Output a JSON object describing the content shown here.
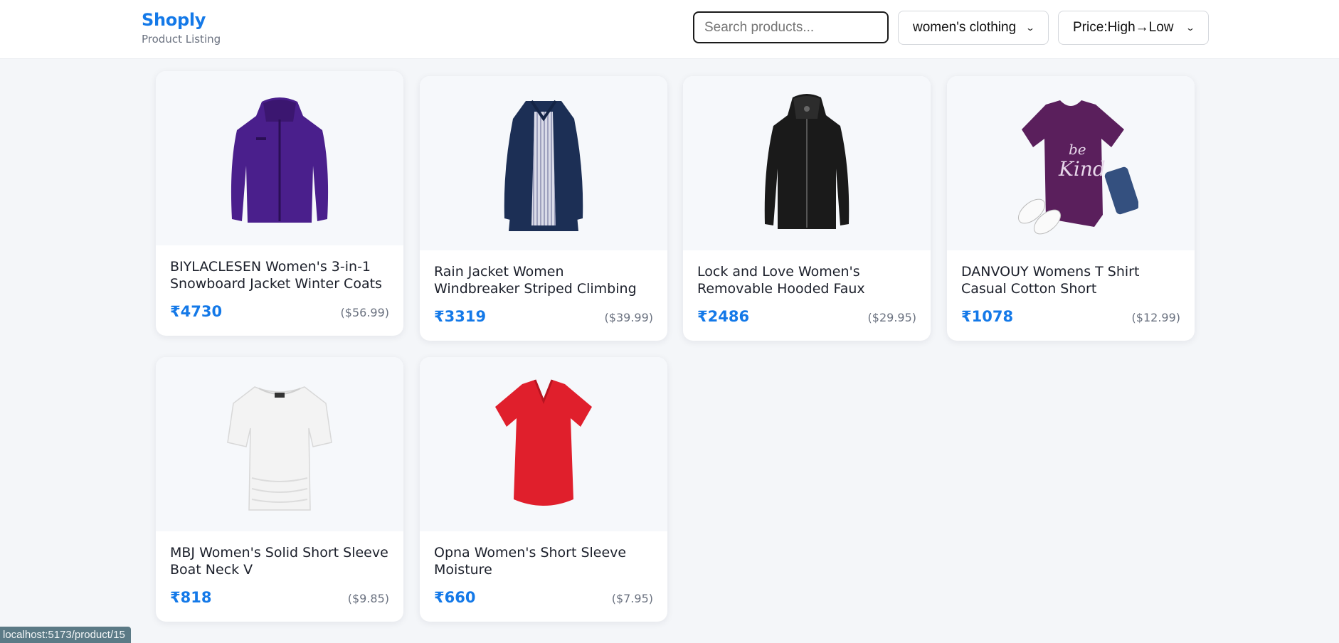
{
  "header": {
    "brand": "Shoply",
    "subtitle": "Product Listing",
    "search": {
      "placeholder": "Search products...",
      "value": ""
    },
    "category_select": {
      "selected": "women's clothing"
    },
    "sort_select": {
      "selected": "Price:High→Low"
    }
  },
  "products": [
    {
      "title": "BIYLACLESEN Women's 3-in-1 Snowboard Jacket Winter Coats",
      "price_inr": "₹4730",
      "price_usd": "($56.99)",
      "image": "purple-jacket"
    },
    {
      "title": "Rain Jacket Women Windbreaker Striped Climbing Raincoats",
      "price_inr": "₹3319",
      "price_usd": "($39.99)",
      "image": "navy-raincoat"
    },
    {
      "title": "Lock and Love Women's Removable Hooded Faux Leather",
      "price_inr": "₹2486",
      "price_usd": "($29.95)",
      "image": "black-leather-jacket"
    },
    {
      "title": "DANVOUY Womens T Shirt Casual Cotton Short",
      "price_inr": "₹1078",
      "price_usd": "($12.99)",
      "image": "purple-tshirt"
    },
    {
      "title": "MBJ Women's Solid Short Sleeve Boat Neck V",
      "price_inr": "₹818",
      "price_usd": "($9.85)",
      "image": "white-top"
    },
    {
      "title": "Opna Women's Short Sleeve Moisture",
      "price_inr": "₹660",
      "price_usd": "($7.95)",
      "image": "red-tshirt"
    }
  ],
  "status_bar": {
    "url": "localhost:5173/product/15"
  },
  "colors": {
    "accent": "#1479e8",
    "background": "#f4f6f9"
  }
}
